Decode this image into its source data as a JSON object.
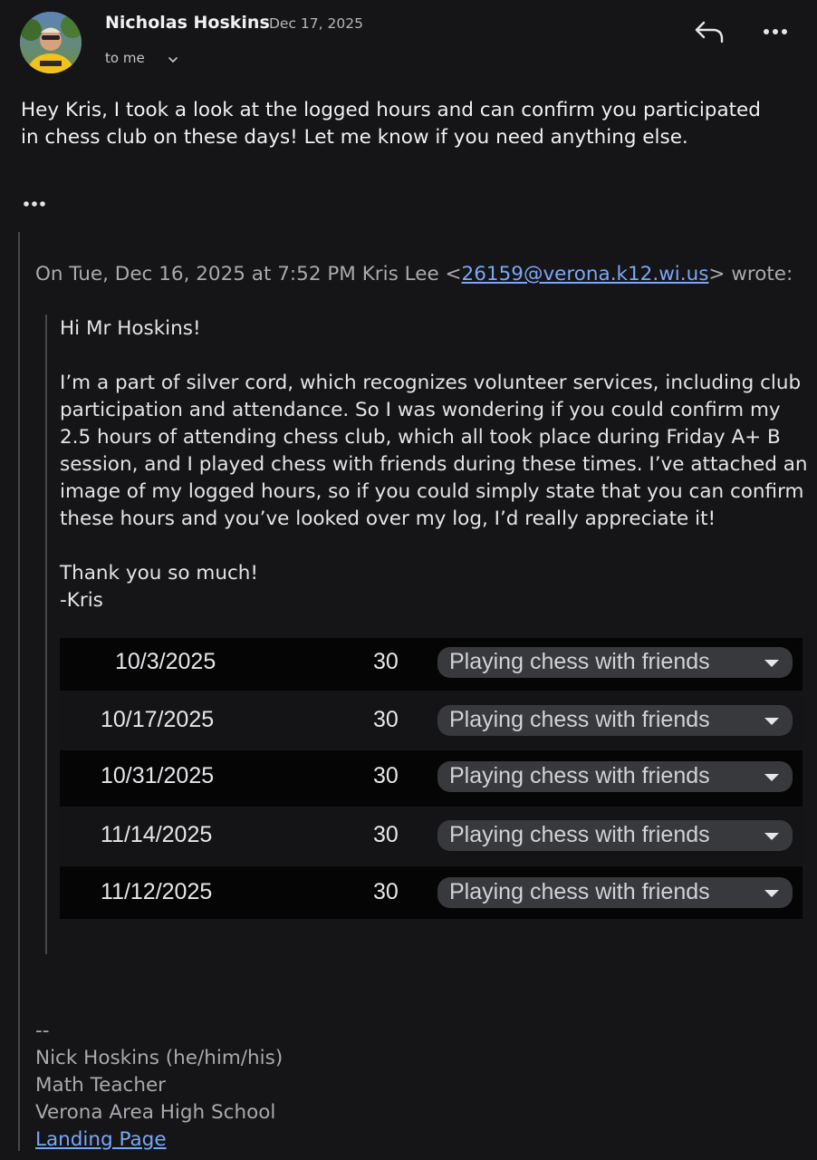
{
  "header": {
    "sender_name": "Nicholas Hoskins",
    "date": "Dec 17, 2025",
    "recipient_label": "to me"
  },
  "message": {
    "body": "Hey Kris, I took a look at the logged hours and can confirm you participated in chess club on these days! Let me know if you need anything else."
  },
  "quote": {
    "attribution_prefix": "On Tue, Dec 16, 2025 at 7:52 PM Kris Lee <",
    "email": "26159@verona.k12.wi.us",
    "attribution_suffix": "> wrote:",
    "greeting": "Hi Mr Hoskins!",
    "paragraph": "I’m a part of silver cord, which recognizes volunteer services, including club participation and attendance. So I was wondering if you could confirm my 2.5 hours of attending chess club, which all took place during Friday A+ B session, and I played chess with friends during these times. I’ve attached an image of my logged hours, so if you could simply state that you can confirm these hours and you’ve looked over my log, I’d really appreciate it!",
    "thanks": "Thank you so much!",
    "sign_off": "-Kris"
  },
  "log": {
    "rows": [
      {
        "date": "10/3/2025",
        "minutes": "30",
        "activity": "Playing chess with friends"
      },
      {
        "date": "10/17/2025",
        "minutes": "30",
        "activity": "Playing chess with friends"
      },
      {
        "date": "10/31/2025",
        "minutes": "30",
        "activity": "Playing chess with friends"
      },
      {
        "date": "11/14/2025",
        "minutes": "30",
        "activity": "Playing chess with friends"
      },
      {
        "date": "11/12/2025",
        "minutes": "30",
        "activity": "Playing chess with friends"
      }
    ]
  },
  "signature": {
    "separator": "--",
    "name": "Nick Hoskins (he/him/his)",
    "title": "Math Teacher",
    "school": "Verona Area High School",
    "link_text": "Landing Page"
  },
  "icons": {
    "reply": "reply-icon",
    "more": "more-options-icon",
    "expand": "chevron-down-icon",
    "show_trimmed": "ellipsis-icon",
    "dropdown": "dropdown-caret-icon"
  },
  "colors": {
    "background": "#151517",
    "link": "#7aa7f5",
    "quote_text": "#a9a9ae",
    "chip": "#38393d"
  }
}
